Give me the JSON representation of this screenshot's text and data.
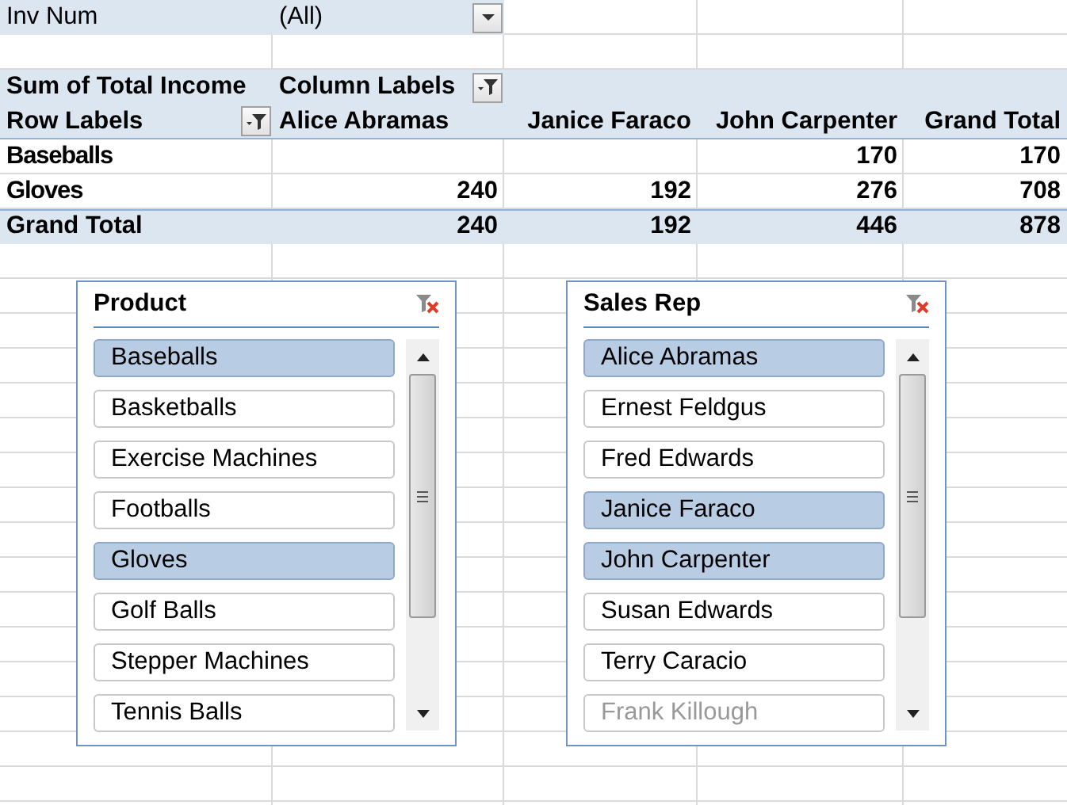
{
  "report_filter": {
    "label": "Inv Num",
    "value": "(All)"
  },
  "pivot": {
    "value_label": "Sum of Total Income",
    "column_labels": "Column Labels",
    "row_labels": "Row Labels",
    "columns": [
      "Alice Abramas",
      "Janice Faraco",
      "John Carpenter",
      "Grand Total"
    ],
    "rows": [
      {
        "label": "Baseballs",
        "values": [
          {
            "blank": true
          },
          {
            "blank": true
          },
          {
            "blank": false,
            "value": "170"
          },
          {
            "blank": false,
            "value": "170"
          }
        ]
      },
      {
        "label": "Gloves",
        "values": [
          {
            "blank": false,
            "value": "240"
          },
          {
            "blank": false,
            "value": "192"
          },
          {
            "blank": false,
            "value": "276"
          },
          {
            "blank": false,
            "value": "708"
          }
        ]
      }
    ],
    "grand_total": {
      "label": "Grand Total",
      "values": [
        "240",
        "192",
        "446",
        "878"
      ]
    }
  },
  "slicers": [
    {
      "title": "Product",
      "items": [
        {
          "label": "Baseballs",
          "selected": true,
          "disabled": false
        },
        {
          "label": "Basketballs",
          "selected": false,
          "disabled": false
        },
        {
          "label": "Exercise Machines",
          "selected": false,
          "disabled": false
        },
        {
          "label": "Footballs",
          "selected": false,
          "disabled": false
        },
        {
          "label": "Gloves",
          "selected": true,
          "disabled": false
        },
        {
          "label": "Golf Balls",
          "selected": false,
          "disabled": false
        },
        {
          "label": "Stepper Machines",
          "selected": false,
          "disabled": false
        },
        {
          "label": "Tennis Balls",
          "selected": false,
          "disabled": false
        }
      ]
    },
    {
      "title": "Sales Rep",
      "items": [
        {
          "label": "Alice Abramas",
          "selected": true,
          "disabled": false
        },
        {
          "label": "Ernest Feldgus",
          "selected": false,
          "disabled": false
        },
        {
          "label": "Fred Edwards",
          "selected": false,
          "disabled": false
        },
        {
          "label": "Janice Faraco",
          "selected": true,
          "disabled": false
        },
        {
          "label": "John Carpenter",
          "selected": true,
          "disabled": false
        },
        {
          "label": "Susan Edwards",
          "selected": false,
          "disabled": false
        },
        {
          "label": "Terry Caracio",
          "selected": false,
          "disabled": false
        },
        {
          "label": "Frank Killough",
          "selected": false,
          "disabled": true
        }
      ]
    }
  ]
}
